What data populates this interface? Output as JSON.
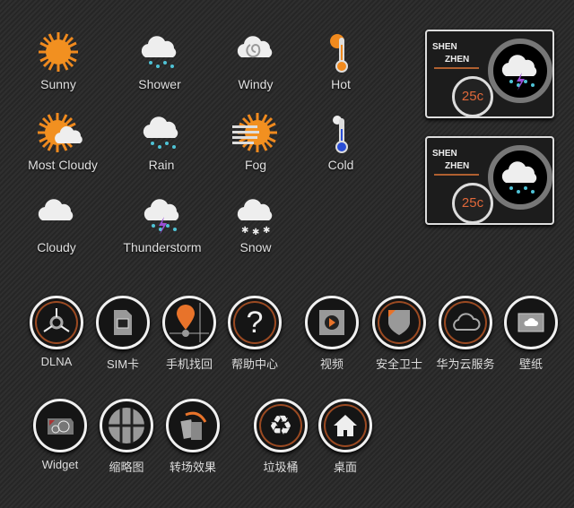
{
  "weather": [
    {
      "label": "Sunny",
      "icon": "sun-icon"
    },
    {
      "label": "Shower",
      "icon": "shower-icon"
    },
    {
      "label": "Windy",
      "icon": "windy-icon"
    },
    {
      "label": "Hot",
      "icon": "thermometer-hot-icon"
    },
    {
      "label": "Most Cloudy",
      "icon": "mostly-cloudy-icon"
    },
    {
      "label": "Rain",
      "icon": "rain-icon"
    },
    {
      "label": "Fog",
      "icon": "fog-icon"
    },
    {
      "label": "Cold",
      "icon": "thermometer-cold-icon"
    },
    {
      "label": "Cloudy",
      "icon": "cloud-icon"
    },
    {
      "label": "Thunderstorm",
      "icon": "thunderstorm-icon"
    },
    {
      "label": "Snow",
      "icon": "snow-icon"
    }
  ],
  "widgets": [
    {
      "city1": "SHEN",
      "city2": "ZHEN",
      "temp": "25c",
      "icon": "thunderstorm-icon"
    },
    {
      "city1": "SHEN",
      "city2": "ZHEN",
      "temp": "25c",
      "icon": "rain-icon"
    }
  ],
  "apps": [
    {
      "label": "DLNA",
      "icon": "dlna-icon"
    },
    {
      "label": "SIM卡",
      "icon": "sim-card-icon"
    },
    {
      "label": "手机找回",
      "icon": "locate-phone-icon"
    },
    {
      "label": "帮助中心",
      "icon": "help-icon"
    },
    {
      "label": "视频",
      "icon": "video-icon"
    },
    {
      "label": "安全卫士",
      "icon": "shield-icon"
    },
    {
      "label": "华为云服务",
      "icon": "cloud-service-icon"
    },
    {
      "label": "壁纸",
      "icon": "wallpaper-icon"
    },
    {
      "label": "Widget",
      "icon": "widget-icon"
    },
    {
      "label": "缩略图",
      "icon": "thumbnail-grid-icon"
    },
    {
      "label": "转场效果",
      "icon": "transition-icon"
    },
    {
      "label": "垃圾桶",
      "icon": "recycle-icon"
    },
    {
      "label": "桌面",
      "icon": "home-icon"
    }
  ],
  "colors": {
    "accent": "#e8732a",
    "ring": "#f0f0f0",
    "bolt": "#9a4fd6",
    "rain": "#4fc3d6"
  }
}
